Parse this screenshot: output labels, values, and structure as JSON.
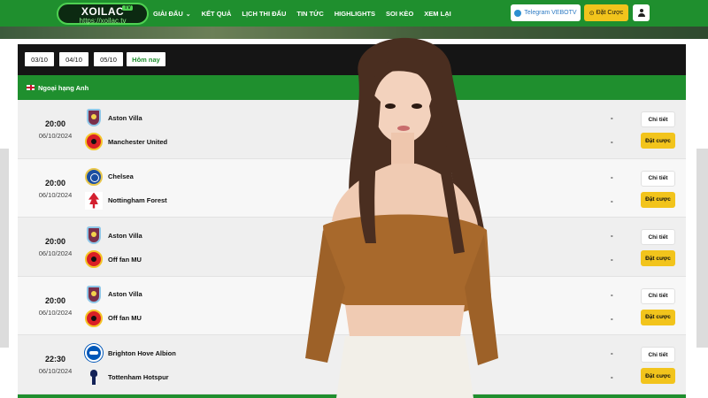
{
  "header": {
    "logo_name": "XOILAC",
    "logo_badge": "TV",
    "logo_url": "https://xoilac.tv",
    "nav": [
      {
        "label": "GIẢI ĐẤU",
        "has_dropdown": true
      },
      {
        "label": "KẾT QUẢ"
      },
      {
        "label": "LỊCH THI ĐẤU"
      },
      {
        "label": "TIN TỨC"
      },
      {
        "label": "HIGHLIGHTS"
      },
      {
        "label": "SOI KÈO"
      },
      {
        "label": "XEM LẠI"
      }
    ],
    "telegram_label": "Telegram VEBOTV",
    "bet_label": "Đặt Cược",
    "user_icon": "user-icon"
  },
  "dates": [
    "03/10",
    "04/10",
    "05/10"
  ],
  "today_label": "Hôm nay",
  "league": "Ngoại hạng Anh",
  "matches": [
    {
      "time": "20:00",
      "date": "06/10/2024",
      "home": "Aston Villa",
      "away": "Manchester United",
      "home_crest": "villa",
      "away_crest": "mu",
      "home_score": "-",
      "away_score": "-",
      "detail": "Chi tiết",
      "bet": "Đặt cược"
    },
    {
      "time": "20:00",
      "date": "06/10/2024",
      "home": "Chelsea",
      "away": "Nottingham Forest",
      "home_crest": "chelsea",
      "away_crest": "forest",
      "home_score": "-",
      "away_score": "-",
      "detail": "Chi tiết",
      "bet": "Đặt cược"
    },
    {
      "time": "20:00",
      "date": "06/10/2024",
      "home": "Aston Villa",
      "away": "Off fan MU",
      "home_crest": "villa",
      "away_crest": "mu",
      "home_score": "-",
      "away_score": "-",
      "detail": "Chi tiết",
      "bet": "Đặt cược"
    },
    {
      "time": "20:00",
      "date": "06/10/2024",
      "home": "Aston Villa",
      "away": "Off fan MU",
      "home_crest": "villa",
      "away_crest": "mu",
      "home_score": "-",
      "away_score": "-",
      "detail": "Chi tiết",
      "bet": "Đặt cược"
    },
    {
      "time": "22:30",
      "date": "06/10/2024",
      "home": "Brighton Hove Albion",
      "away": "Tottenham Hotspur",
      "home_crest": "brighton",
      "away_crest": "spurs",
      "home_score": "-",
      "away_score": "-",
      "detail": "Chi tiết",
      "bet": "Đặt cược"
    }
  ],
  "colors": {
    "brand_green": "#1f8f2e",
    "dark_bar": "#151515",
    "bet_yellow": "#f2c41c"
  }
}
